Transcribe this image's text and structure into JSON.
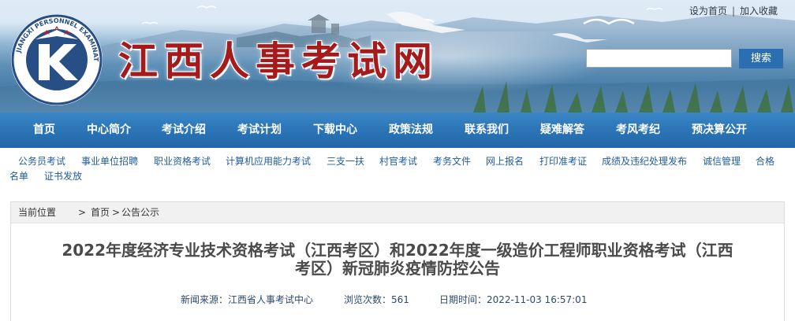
{
  "header": {
    "site_title": "江西人事考试网",
    "logo_text": "JIANGXI PERSONNEL EXAMINATION CENTER",
    "top_links": {
      "set_home": "设为首页",
      "separator": "|",
      "favorite": "加入收藏"
    },
    "search": {
      "placeholder": "",
      "value": "",
      "button_label": "搜索"
    }
  },
  "main_nav": [
    "首页",
    "中心简介",
    "考试介绍",
    "考试计划",
    "下载中心",
    "政策法规",
    "联系我们",
    "疑难解答",
    "考风考纪",
    "预决算公开"
  ],
  "sub_nav": [
    "公务员考试",
    "事业单位招聘",
    "职业资格考试",
    "计算机应用能力考试",
    "三支一扶",
    "村官考试",
    "考务文件",
    "网上报名",
    "打印准考证",
    "成绩及违纪处理发布",
    "诚信管理",
    "合格",
    "名单",
    "证书发放"
  ],
  "breadcrumb": {
    "label": "当前位置",
    "arrow": ">",
    "home": "首页",
    "section": "公告公示"
  },
  "article": {
    "title_line1": "2022年度经济专业技术资格考试（江西考区）和2022年度一级造价工程师职业资格考试（江西",
    "title_line2": "考区）新冠肺炎疫情防控公告",
    "source": "新闻来源：江西省人事考试中心",
    "views": "浏览次数：561",
    "date": "日期时间：2022-11-03 16:57:01"
  },
  "colors": {
    "nav_blue": "#2a73b5",
    "title_red": "#a51b1b",
    "link_blue": "#215d9b"
  }
}
